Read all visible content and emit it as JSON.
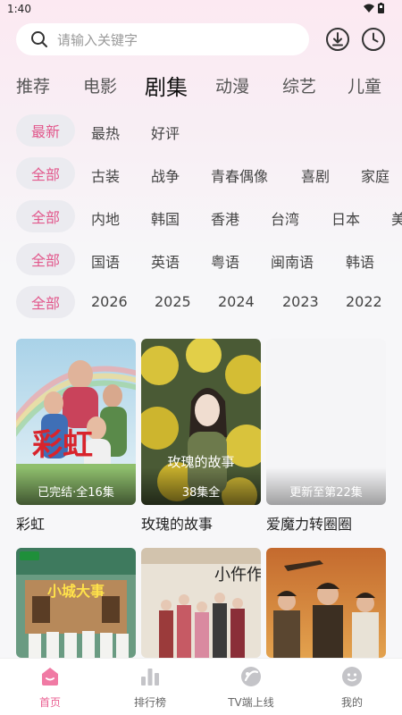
{
  "status": {
    "time": "1:40"
  },
  "search": {
    "placeholder": "请输入关键字"
  },
  "categories": [
    "推荐",
    "电影",
    "剧集",
    "动漫",
    "综艺",
    "儿童"
  ],
  "active_category": "剧集",
  "filters": {
    "sort": {
      "active": "最新",
      "options": [
        "最热",
        "好评"
      ]
    },
    "genre": {
      "active": "全部",
      "options": [
        "古装",
        "战争",
        "青春偶像",
        "喜剧",
        "家庭"
      ]
    },
    "region": {
      "active": "全部",
      "options": [
        "内地",
        "韩国",
        "香港",
        "台湾",
        "日本",
        "美"
      ]
    },
    "language": {
      "active": "全部",
      "options": [
        "国语",
        "英语",
        "粤语",
        "闽南语",
        "韩语"
      ]
    },
    "year": {
      "active": "全部",
      "options": [
        "2026",
        "2025",
        "2024",
        "2023",
        "2022"
      ]
    }
  },
  "videos": [
    {
      "title": "彩虹",
      "status": "已完结·全16集",
      "poster_text": "彩虹"
    },
    {
      "title": "玫瑰的故事",
      "status": "38集全",
      "poster_text": "玫瑰的故事"
    },
    {
      "title": "爱魔力转圈圈",
      "status": "更新至第22集",
      "poster_text": ""
    },
    {
      "title": "",
      "status": "",
      "poster_text": "小城大事"
    },
    {
      "title": "",
      "status": "",
      "poster_text": "小仵作"
    },
    {
      "title": "",
      "status": "",
      "poster_text": ""
    }
  ],
  "bottom_nav": [
    {
      "label": "首页",
      "icon": "home-icon",
      "active": true
    },
    {
      "label": "排行榜",
      "icon": "chart-icon",
      "active": false
    },
    {
      "label": "TV端上线",
      "icon": "tv-icon",
      "active": false
    },
    {
      "label": "我的",
      "icon": "profile-icon",
      "active": false
    }
  ],
  "colors": {
    "accent": "#e2588c",
    "nav_active": "#ea5f92",
    "pill_bg": "#ebebf0"
  }
}
